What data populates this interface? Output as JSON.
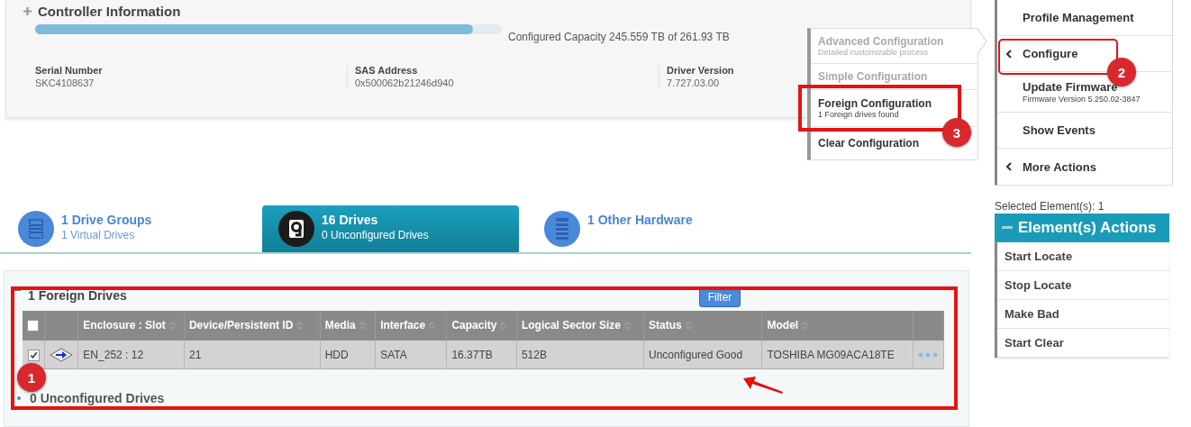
{
  "controller": {
    "title": "Controller Information",
    "capacity": {
      "level": 0.9375,
      "text": "Configured Capacity 245.559 TB of 261.93 TB"
    },
    "fields": [
      {
        "label": "Serial Number",
        "value": "SKC4108637"
      },
      {
        "label": "SAS Address",
        "value": "0x500062b21246d940"
      },
      {
        "label": "Driver Version",
        "value": "7.727.03.00"
      }
    ]
  },
  "tabs": [
    {
      "title": "1 Drive Groups",
      "subtitle": "1 Virtual Drives",
      "selected": false,
      "kind": "groups"
    },
    {
      "title": "16 Drives",
      "subtitle": "0 Unconfigured Drives",
      "selected": true,
      "kind": "drive"
    },
    {
      "title": "1 Other Hardware",
      "selected": false,
      "kind": "hardware"
    }
  ],
  "foreign_section": {
    "title": "1 Foreign Drives",
    "filter": "Filter",
    "columns": [
      "Enclosure : Slot",
      "Device/Persistent ID",
      "Media",
      "Interface",
      "Capacity",
      "Logical Sector Size",
      "Status",
      "Model"
    ],
    "header_checked": false,
    "rows": [
      {
        "checked": true,
        "cells": [
          "EN_252 : 12",
          "21",
          "HDD",
          "SATA",
          "16.37TB",
          "512B",
          "Unconfigured Good",
          "TOSHIBA MG09ACA18TE"
        ]
      }
    ]
  },
  "unconfigured_section": {
    "title": "0 Unconfigured Drives"
  },
  "submenu": [
    {
      "title": "Advanced Configuration",
      "subtitle": "Detailed customizable process",
      "disabled": true
    },
    {
      "title": "Simple Configuration",
      "disabled": true
    },
    {
      "title": "Foreign Configuration",
      "subtitle": "1 Foreign drives found",
      "disabled": false
    },
    {
      "title": "Clear Configuration",
      "disabled": false
    }
  ],
  "actions_menu": [
    {
      "title": "Profile Management",
      "kind": "plain"
    },
    {
      "title": "Configure",
      "kind": "submenu"
    },
    {
      "title": "Update Firmware",
      "subtitle": "Firmware Version 5.250.02-3847",
      "kind": "plain"
    },
    {
      "title": "Show Events",
      "kind": "plain"
    },
    {
      "title": "More Actions",
      "kind": "submenu"
    }
  ],
  "selected_elements": "Selected Element(s): 1",
  "element_actions": {
    "title": "Element(s) Actions",
    "items": [
      "Start Locate",
      "Stop Locate",
      "Make Bad",
      "Start Clear"
    ]
  },
  "markers": [
    "1",
    "2",
    "3"
  ]
}
